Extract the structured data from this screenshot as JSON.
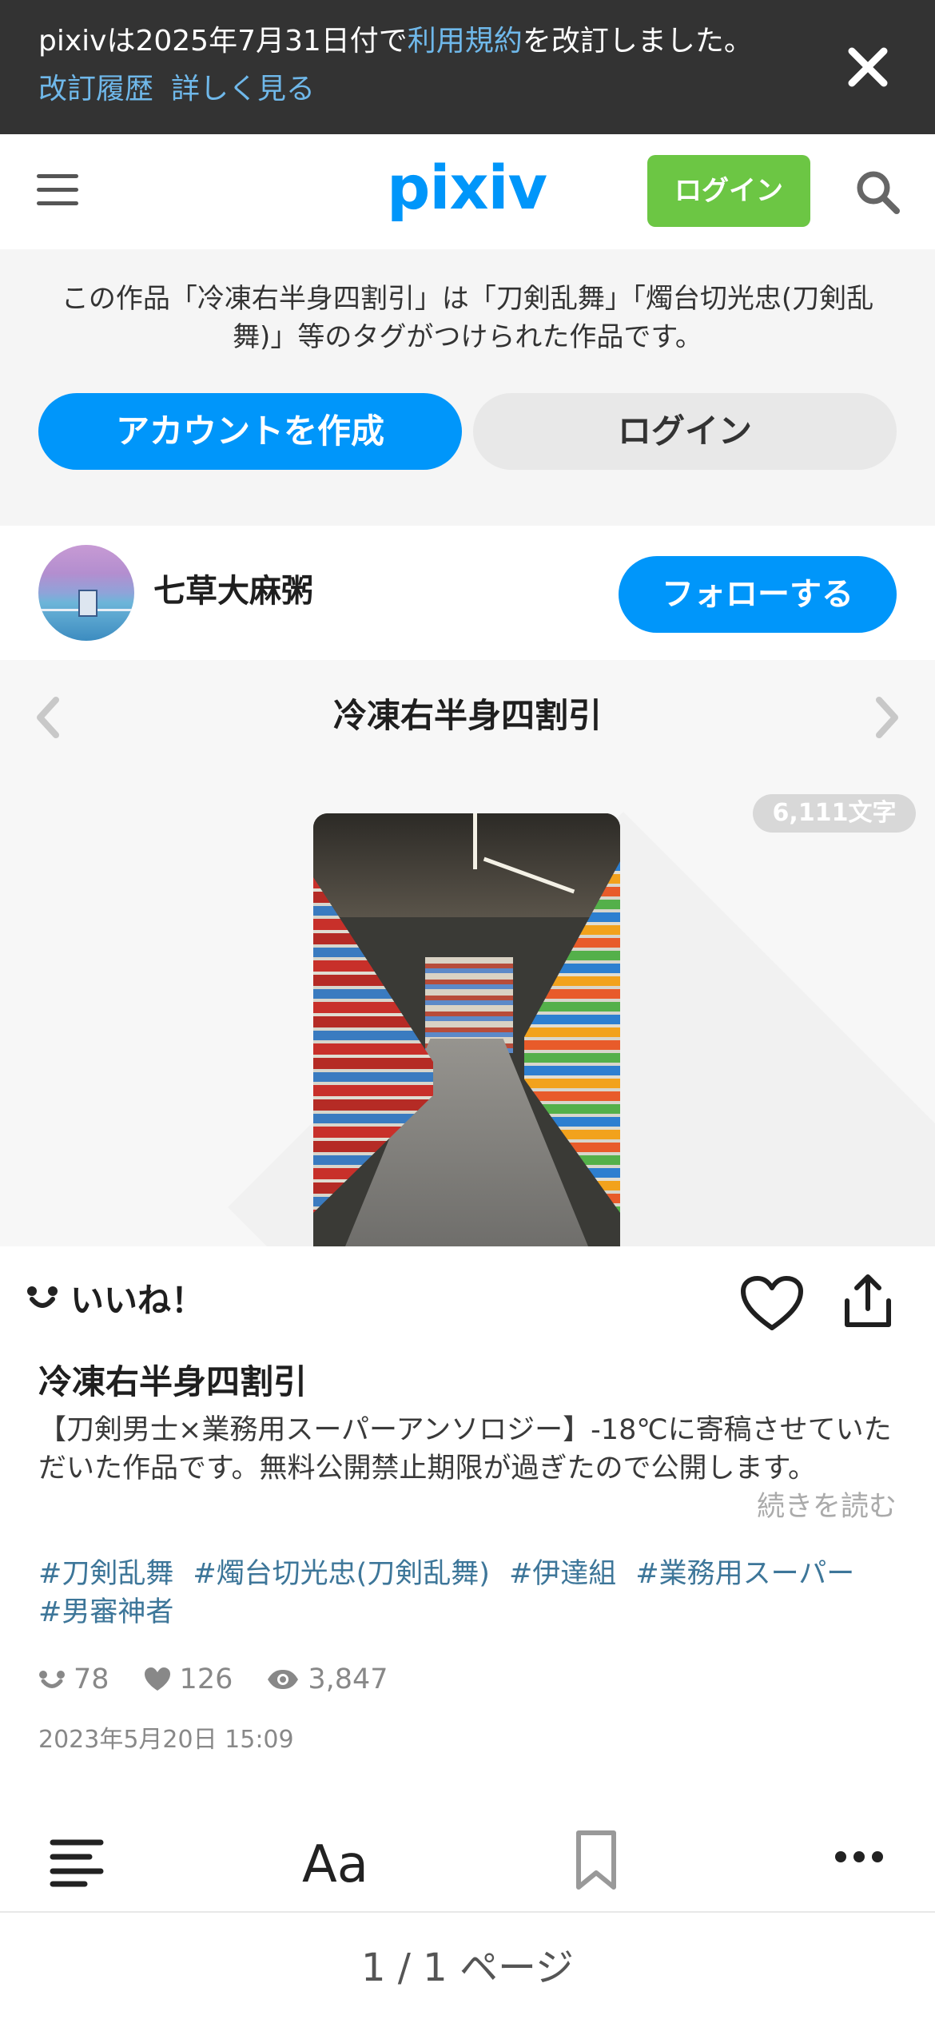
{
  "notice": {
    "text_before": "pixivは2025年7月31日付で",
    "terms_link": "利用規約",
    "text_after": "を改訂しました。",
    "history_link": "改訂履歴",
    "details_link": "詳しく見る",
    "close_icon": "close-icon"
  },
  "header": {
    "logo": "pixiv",
    "login_label": "ログイン",
    "menu_icon": "hamburger-icon",
    "search_icon": "search-icon"
  },
  "intro": {
    "text": "この作品「冷凍右半身四割引」は「刀剣乱舞」「燭台切光忠(刀剣乱舞)」等のタグがつけられた作品です。",
    "create_account_label": "アカウントを作成",
    "login_label": "ログイン"
  },
  "author": {
    "name": "七草大麻粥",
    "follow_label": "フォローする"
  },
  "work": {
    "title": "冷凍右半身四割引",
    "char_count": "6,111文字",
    "like_label": "いいね！",
    "caption": "【刀剣男士×業務用スーパーアンソロジー】-18℃に寄稿させていただいた作品です。無料公開禁止期限が過ぎたので公開します。",
    "read_more": "続きを読む",
    "tags": [
      "#刀剣乱舞",
      "#燭台切光忠(刀剣乱舞)",
      "#伊達組",
      "#業務用スーパー",
      "#男審神者"
    ],
    "stats": {
      "likes": "78",
      "bookmarks": "126",
      "views": "3,847"
    },
    "date": "2023年5月20日 15:09"
  },
  "toolbar": {
    "font_label": "Aa",
    "pager": "1 / 1 ページ"
  },
  "colors": {
    "accent": "#0096fa",
    "login_green": "#6cc644",
    "banner_bg": "#333333",
    "tag_blue": "#3d7699"
  }
}
